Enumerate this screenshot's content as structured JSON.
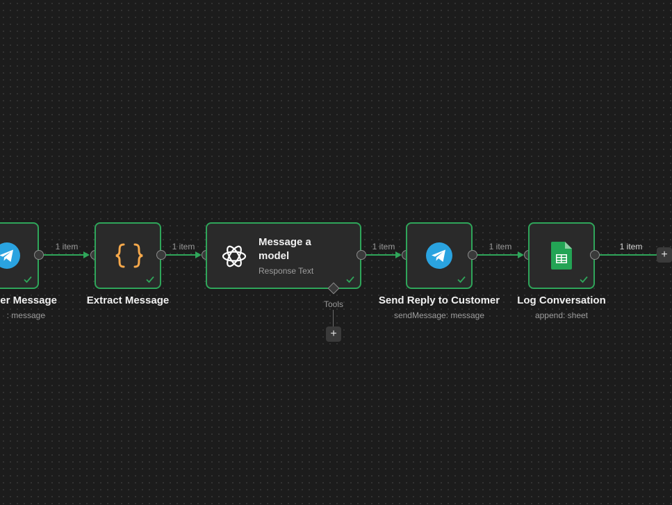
{
  "connection_label": "1 item",
  "nodes": {
    "trigger": {
      "title": "er Message",
      "subtitle": ": message",
      "icon": "telegram-icon"
    },
    "extract": {
      "title": "Extract Message",
      "icon": "braces-icon"
    },
    "model": {
      "title_line1": "Message a",
      "title_line2": "model",
      "subtitle": "Response Text",
      "icon": "openai-icon"
    },
    "reply": {
      "title": "Send Reply to Customer",
      "subtitle": "sendMessage: message",
      "icon": "telegram-icon"
    },
    "log": {
      "title": "Log Conversation",
      "subtitle": "append: sheet",
      "icon": "google-sheets-icon"
    }
  },
  "tools": {
    "label": "Tools",
    "add_symbol": "+"
  },
  "end_add_symbol": "+",
  "colors": {
    "background": "#1c1c1c",
    "node_bg": "#2a2a2a",
    "success_green": "#2fa65a",
    "telegram_blue": "#2aa3e0",
    "code_orange": "#f5a84b",
    "sheets_green": "#23a455"
  }
}
